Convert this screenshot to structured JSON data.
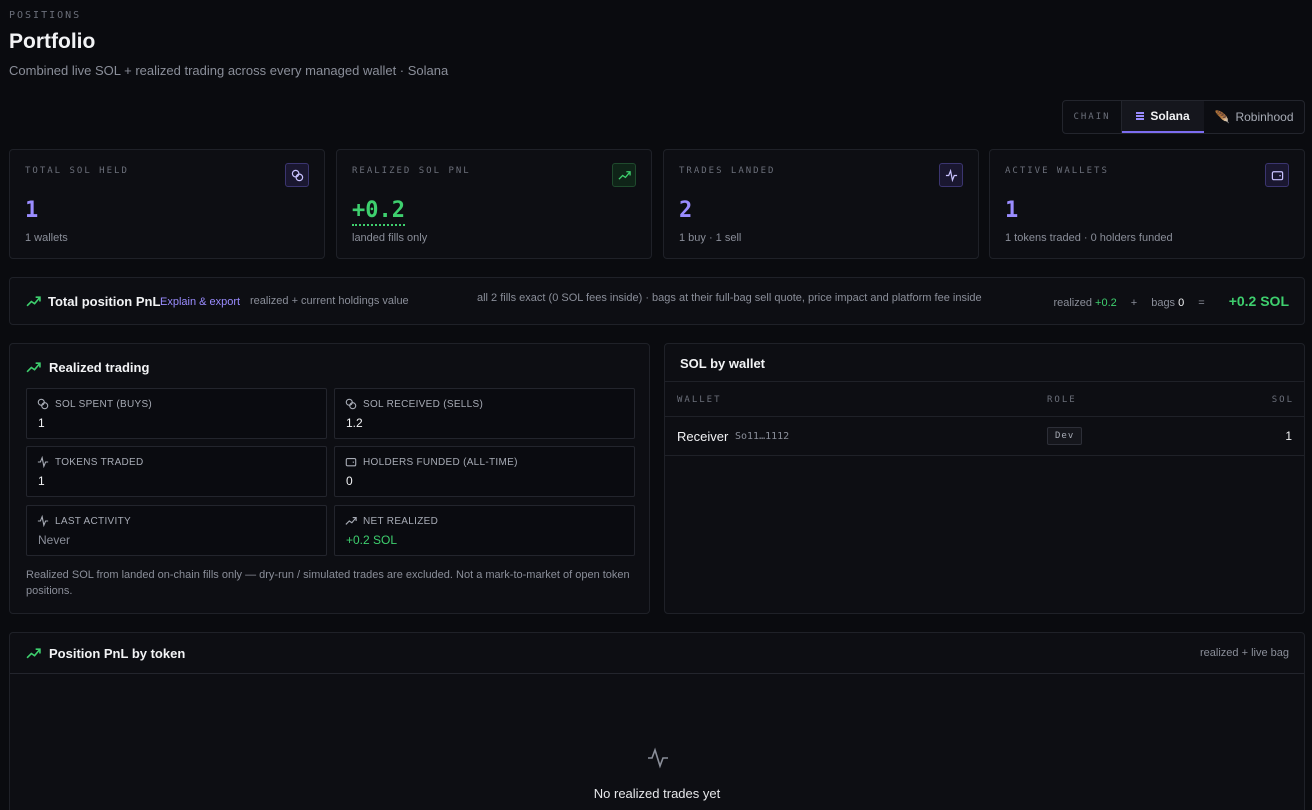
{
  "header": {
    "eyebrow": "POSITIONS",
    "title": "Portfolio",
    "subtitle": "Combined live SOL + realized trading across every managed wallet · Solana"
  },
  "chain": {
    "label": "CHAIN",
    "options": [
      "Solana",
      "Robinhood"
    ],
    "selected": "Solana"
  },
  "stats": [
    {
      "label": "TOTAL SOL HELD",
      "value": "1",
      "sub": "1 wallets",
      "icon": "coins-icon"
    },
    {
      "label": "REALIZED SOL PNL",
      "value": "+0.2",
      "sub": "landed fills only",
      "icon": "trending-up-icon"
    },
    {
      "label": "TRADES LANDED",
      "value": "2",
      "sub": "1 buy · 1 sell",
      "icon": "activity-icon"
    },
    {
      "label": "ACTIVE WALLETS",
      "value": "1",
      "sub": "1 tokens traded · 0 holders funded",
      "icon": "wallet-icon"
    }
  ],
  "pnl": {
    "title": "Total position PnL",
    "link": "Explain & export",
    "hint": "realized + current holdings value",
    "note": "all 2 fills exact (0 SOL fees inside) · bags at their full-bag sell quote, price impact and platform fee inside",
    "realized_label": "realized",
    "realized_value": "+0.2",
    "plus": "+",
    "bags_label": "bags",
    "bags_value": "0",
    "equals": "=",
    "total": "+0.2 SOL"
  },
  "realized": {
    "title": "Realized trading",
    "cells": [
      {
        "label": "SOL SPENT (BUYS)",
        "value": "1"
      },
      {
        "label": "SOL RECEIVED (SELLS)",
        "value": "1.2"
      },
      {
        "label": "TOKENS TRADED",
        "value": "1"
      },
      {
        "label": "HOLDERS FUNDED (ALL-TIME)",
        "value": "0"
      },
      {
        "label": "LAST ACTIVITY",
        "value": "Never"
      },
      {
        "label": "NET REALIZED",
        "value": "+0.2 SOL"
      }
    ],
    "note": "Realized SOL from landed on-chain fills only — dry-run / simulated trades are excluded. Not a mark-to-market of open token positions."
  },
  "wallets": {
    "title": "SOL by wallet",
    "columns": [
      "WALLET",
      "ROLE",
      "SOL"
    ],
    "rows": [
      {
        "name": "Receiver",
        "address": "So11…1112",
        "role": "Dev",
        "sol": "1"
      }
    ]
  },
  "by_token": {
    "title": "Position PnL by token",
    "hint": "realized + live bag",
    "empty": "No realized trades yet"
  },
  "colors": {
    "accent": "#9a8cff",
    "positive": "#3ecf6e",
    "background": "#0a0b0f"
  }
}
